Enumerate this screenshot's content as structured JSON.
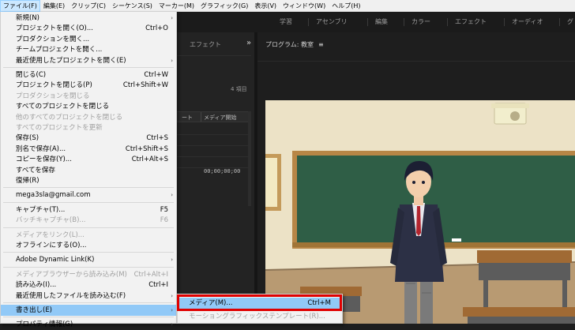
{
  "menubar": {
    "items": [
      {
        "label": "ファイル(F)",
        "active": true
      },
      {
        "label": "編集(E)",
        "active": false
      },
      {
        "label": "クリップ(C)",
        "active": false
      },
      {
        "label": "シーケンス(S)",
        "active": false
      },
      {
        "label": "マーカー(M)",
        "active": false
      },
      {
        "label": "グラフィック(G)",
        "active": false
      },
      {
        "label": "表示(V)",
        "active": false
      },
      {
        "label": "ウィンドウ(W)",
        "active": false
      },
      {
        "label": "ヘルプ(H)",
        "active": false
      }
    ]
  },
  "workspace_tabs": [
    "学習",
    "アセンブリ",
    "編集",
    "カラー",
    "エフェクト",
    "オーディオ",
    "グ"
  ],
  "project_panel": {
    "tab": "エフェクト",
    "more_icon": "double-chevron-right-icon",
    "item_count": "4 項目",
    "columns": [
      "ート",
      "メディア開始"
    ],
    "timecode": "00;00;00;00"
  },
  "program_monitor": {
    "title": "プログラム: 教室",
    "menu_icon": "hamburger-icon"
  },
  "file_menu": {
    "items": [
      {
        "label": "新規(N)",
        "shortcut": "",
        "submenu": true,
        "disabled": false
      },
      {
        "label": "プロジェクトを開く(O)...",
        "shortcut": "Ctrl+O",
        "submenu": false,
        "disabled": false
      },
      {
        "label": "プロダクションを開く...",
        "shortcut": "",
        "submenu": false,
        "disabled": false
      },
      {
        "label": "チームプロジェクトを開く...",
        "shortcut": "",
        "submenu": false,
        "disabled": false
      },
      {
        "label": "最近使用したプロジェクトを開く(E)",
        "shortcut": "",
        "submenu": true,
        "disabled": false
      },
      {
        "sep": true
      },
      {
        "label": "閉じる(C)",
        "shortcut": "Ctrl+W",
        "submenu": false,
        "disabled": false
      },
      {
        "label": "プロジェクトを閉じる(P)",
        "shortcut": "Ctrl+Shift+W",
        "submenu": false,
        "disabled": false
      },
      {
        "label": "プロダクションを閉じる",
        "shortcut": "",
        "submenu": false,
        "disabled": true
      },
      {
        "label": "すべてのプロジェクトを閉じる",
        "shortcut": "",
        "submenu": false,
        "disabled": false
      },
      {
        "label": "他のすべてのプロジェクトを閉じる",
        "shortcut": "",
        "submenu": false,
        "disabled": true
      },
      {
        "label": "すべてのプロジェクトを更新",
        "shortcut": "",
        "submenu": false,
        "disabled": true
      },
      {
        "label": "保存(S)",
        "shortcut": "Ctrl+S",
        "submenu": false,
        "disabled": false
      },
      {
        "label": "別名で保存(A)...",
        "shortcut": "Ctrl+Shift+S",
        "submenu": false,
        "disabled": false
      },
      {
        "label": "コピーを保存(Y)...",
        "shortcut": "Ctrl+Alt+S",
        "submenu": false,
        "disabled": false
      },
      {
        "label": "すべてを保存",
        "shortcut": "",
        "submenu": false,
        "disabled": false
      },
      {
        "label": "復帰(R)",
        "shortcut": "",
        "submenu": false,
        "disabled": false
      },
      {
        "sep": true
      },
      {
        "label": "mega3sla@gmail.com",
        "shortcut": "",
        "submenu": true,
        "disabled": false
      },
      {
        "sep": true
      },
      {
        "label": "キャプチャ(T)...",
        "shortcut": "F5",
        "submenu": false,
        "disabled": false
      },
      {
        "label": "バッチキャプチャ(B)...",
        "shortcut": "F6",
        "submenu": false,
        "disabled": true
      },
      {
        "sep": true
      },
      {
        "label": "メディアをリンク(L)...",
        "shortcut": "",
        "submenu": false,
        "disabled": true
      },
      {
        "label": "オフラインにする(O)...",
        "shortcut": "",
        "submenu": false,
        "disabled": false
      },
      {
        "sep": true
      },
      {
        "label": "Adobe Dynamic Link(K)",
        "shortcut": "",
        "submenu": true,
        "disabled": false
      },
      {
        "sep": true
      },
      {
        "label": "メディアブラウザーから読み込み(M)",
        "shortcut": "Ctrl+Alt+I",
        "submenu": false,
        "disabled": true
      },
      {
        "label": "読み込み(I)...",
        "shortcut": "Ctrl+I",
        "submenu": false,
        "disabled": false
      },
      {
        "label": "最近使用したファイルを読み込む(F)",
        "shortcut": "",
        "submenu": true,
        "disabled": false
      },
      {
        "sep": true
      },
      {
        "label": "書き出し(E)",
        "shortcut": "",
        "submenu": true,
        "disabled": false,
        "highlighted": true
      },
      {
        "sep": true
      },
      {
        "label": "プロパティ情報(G)",
        "shortcut": "",
        "submenu": true,
        "disabled": false
      }
    ]
  },
  "export_submenu": {
    "items": [
      {
        "label": "メディア(M)...",
        "shortcut": "Ctrl+M",
        "disabled": false,
        "highlighted": true
      },
      {
        "label": "モーショングラフィックステンプレート(R)...",
        "shortcut": "",
        "disabled": true
      }
    ]
  },
  "colors": {
    "menu_highlight": "#91c9f7",
    "callout": "#e00000"
  }
}
